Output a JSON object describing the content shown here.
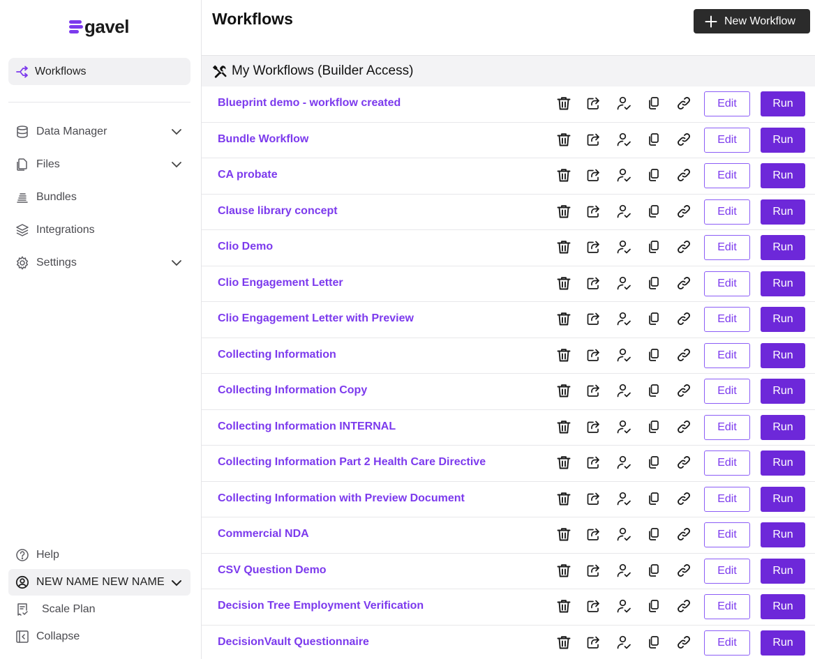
{
  "brand": {
    "name": "gavel",
    "accent": "#7c3aed"
  },
  "sidebar": {
    "active": {
      "label": "Workflows",
      "icon": "workflow-icon"
    },
    "items": [
      {
        "label": "Data Manager",
        "icon": "database-icon",
        "expandable": true
      },
      {
        "label": "Files",
        "icon": "files-icon",
        "expandable": true
      },
      {
        "label": "Bundles",
        "icon": "bundles-icon",
        "expandable": false
      },
      {
        "label": "Integrations",
        "icon": "layers-icon",
        "expandable": false
      },
      {
        "label": "Settings",
        "icon": "gear-icon",
        "expandable": true
      }
    ],
    "bottom": {
      "help": "Help",
      "user": "NEW NAME NEW NAME",
      "plan": "Scale Plan",
      "collapse": "Collapse"
    }
  },
  "header": {
    "title": "Workflows",
    "new_button": "New Workflow"
  },
  "section": {
    "title": "My Workflows (Builder Access)"
  },
  "row_actions": {
    "edit": "Edit",
    "run": "Run"
  },
  "workflows": [
    {
      "name": "Blueprint demo - workflow created"
    },
    {
      "name": "Bundle Workflow"
    },
    {
      "name": "CA probate"
    },
    {
      "name": "Clause library concept"
    },
    {
      "name": "Clio Demo"
    },
    {
      "name": "Clio Engagement Letter"
    },
    {
      "name": "Clio Engagement Letter with Preview"
    },
    {
      "name": "Collecting Information"
    },
    {
      "name": "Collecting Information Copy"
    },
    {
      "name": "Collecting Information INTERNAL"
    },
    {
      "name": "Collecting Information Part 2 Health Care Directive"
    },
    {
      "name": "Collecting Information with Preview Document"
    },
    {
      "name": "Commercial NDA"
    },
    {
      "name": "CSV Question Demo"
    },
    {
      "name": "Decision Tree Employment Verification"
    },
    {
      "name": "DecisionVault Questionnaire"
    }
  ]
}
